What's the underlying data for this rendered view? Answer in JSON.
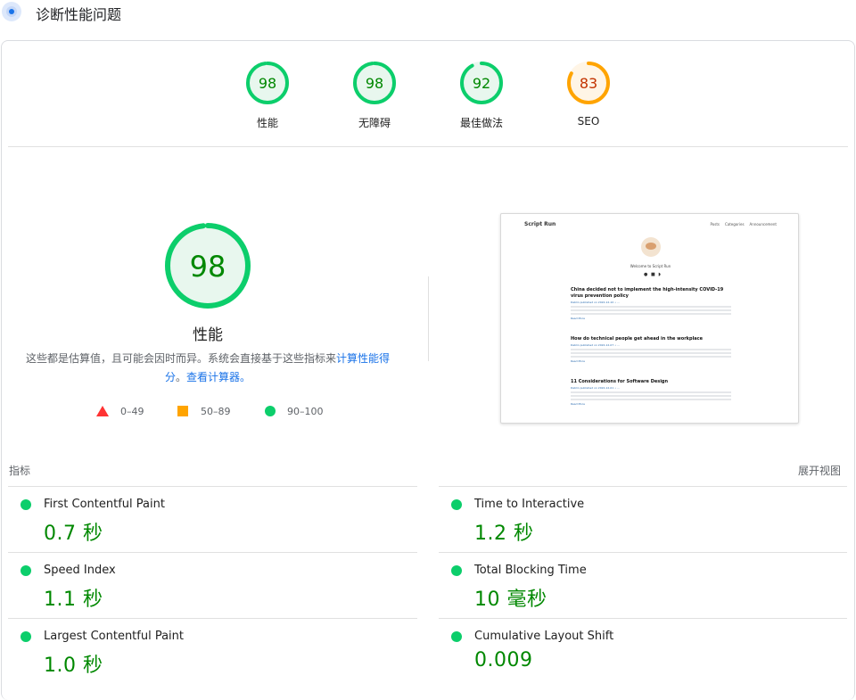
{
  "header": {
    "title": "诊断性能问题",
    "icon": "lighthouse-icon"
  },
  "category_gauges": [
    {
      "score": "98",
      "label": "性能",
      "color": "#0cce6b",
      "text_color": "#008800",
      "fill": 0.98
    },
    {
      "score": "98",
      "label": "无障碍",
      "color": "#0cce6b",
      "text_color": "#008800",
      "fill": 0.98
    },
    {
      "score": "92",
      "label": "最佳做法",
      "color": "#0cce6b",
      "text_color": "#008800",
      "fill": 0.92
    },
    {
      "score": "83",
      "label": "SEO",
      "color": "#ffa400",
      "text_color": "#c33300",
      "fill": 0.83
    }
  ],
  "performance": {
    "score": "98",
    "fill": 0.98,
    "title": "性能",
    "desc_prefix": "这些都是估算值，且可能会因时而异。系统会直接基于这些指标来",
    "desc_link1": "计算性能得分",
    "desc_mid": "。",
    "desc_link2": "查看计算器。",
    "legend": [
      {
        "shape": "triangle",
        "range": "0–49",
        "color": "#ff4e42"
      },
      {
        "shape": "square",
        "range": "50–89",
        "color": "#ffa400"
      },
      {
        "shape": "circle",
        "range": "90–100",
        "color": "#0cce6b"
      }
    ]
  },
  "screenshot": {
    "brand": "Script Run",
    "nav": [
      "Posts",
      "Categories",
      "Announcement"
    ],
    "welcome": "Welcome to Script Run",
    "posts": [
      {
        "title": "China decided not to implement the high-intensity COVID-19 virus prevention policy",
        "meta": "Dablin published on 2022-12-10 • ...",
        "read_more": "Read More"
      },
      {
        "title": "How do technical people get ahead in the workplace",
        "meta": "Dablin published on 2022-12-07 • ...",
        "read_more": "Read More"
      },
      {
        "title": "11 Considerations for Software Design",
        "meta": "Dablin published on 2022-12-01 • ...",
        "read_more": "Read More"
      }
    ]
  },
  "metrics_section": {
    "label": "指标",
    "expand": "展开视图",
    "left": [
      {
        "name": "First Contentful Paint",
        "value": "0.7 秒"
      },
      {
        "name": "Speed Index",
        "value": "1.1 秒"
      },
      {
        "name": "Largest Contentful Paint",
        "value": "1.0 秒"
      }
    ],
    "right": [
      {
        "name": "Time to Interactive",
        "value": "1.2 秒"
      },
      {
        "name": "Total Blocking Time",
        "value": "10 毫秒"
      },
      {
        "name": "Cumulative Layout Shift",
        "value": "0.009"
      }
    ],
    "status_color": "#0cce6b",
    "value_color": "#008800"
  }
}
